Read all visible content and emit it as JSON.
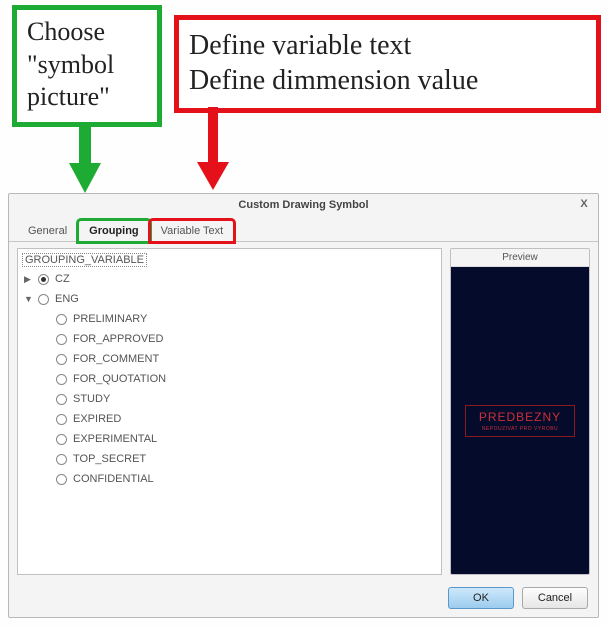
{
  "annotations": {
    "green_line1": "Choose",
    "green_line2": "\"symbol",
    "green_line3": "picture\"",
    "red_line1": "Define variable text",
    "red_line2": "Define dimmension value"
  },
  "dialog": {
    "title": "Custom Drawing Symbol",
    "close": "X",
    "tabs": {
      "general": "General",
      "grouping": "Grouping",
      "variable_text": "Variable Text"
    },
    "buttons": {
      "ok": "OK",
      "cancel": "Cancel"
    }
  },
  "tree": {
    "header": "GROUPING_VARIABLE",
    "cz": "CZ",
    "eng": "ENG",
    "children": [
      "PRELIMINARY",
      "FOR_APPROVED",
      "FOR_COMMENT",
      "FOR_QUOTATION",
      "STUDY",
      "EXPIRED",
      "EXPERIMENTAL",
      "TOP_SECRET",
      "CONFIDENTIAL"
    ]
  },
  "preview": {
    "title": "Preview",
    "stamp_line1": "PREDBEZNY",
    "stamp_line2": "NEPOUZIVAT PRO VYROBU"
  }
}
